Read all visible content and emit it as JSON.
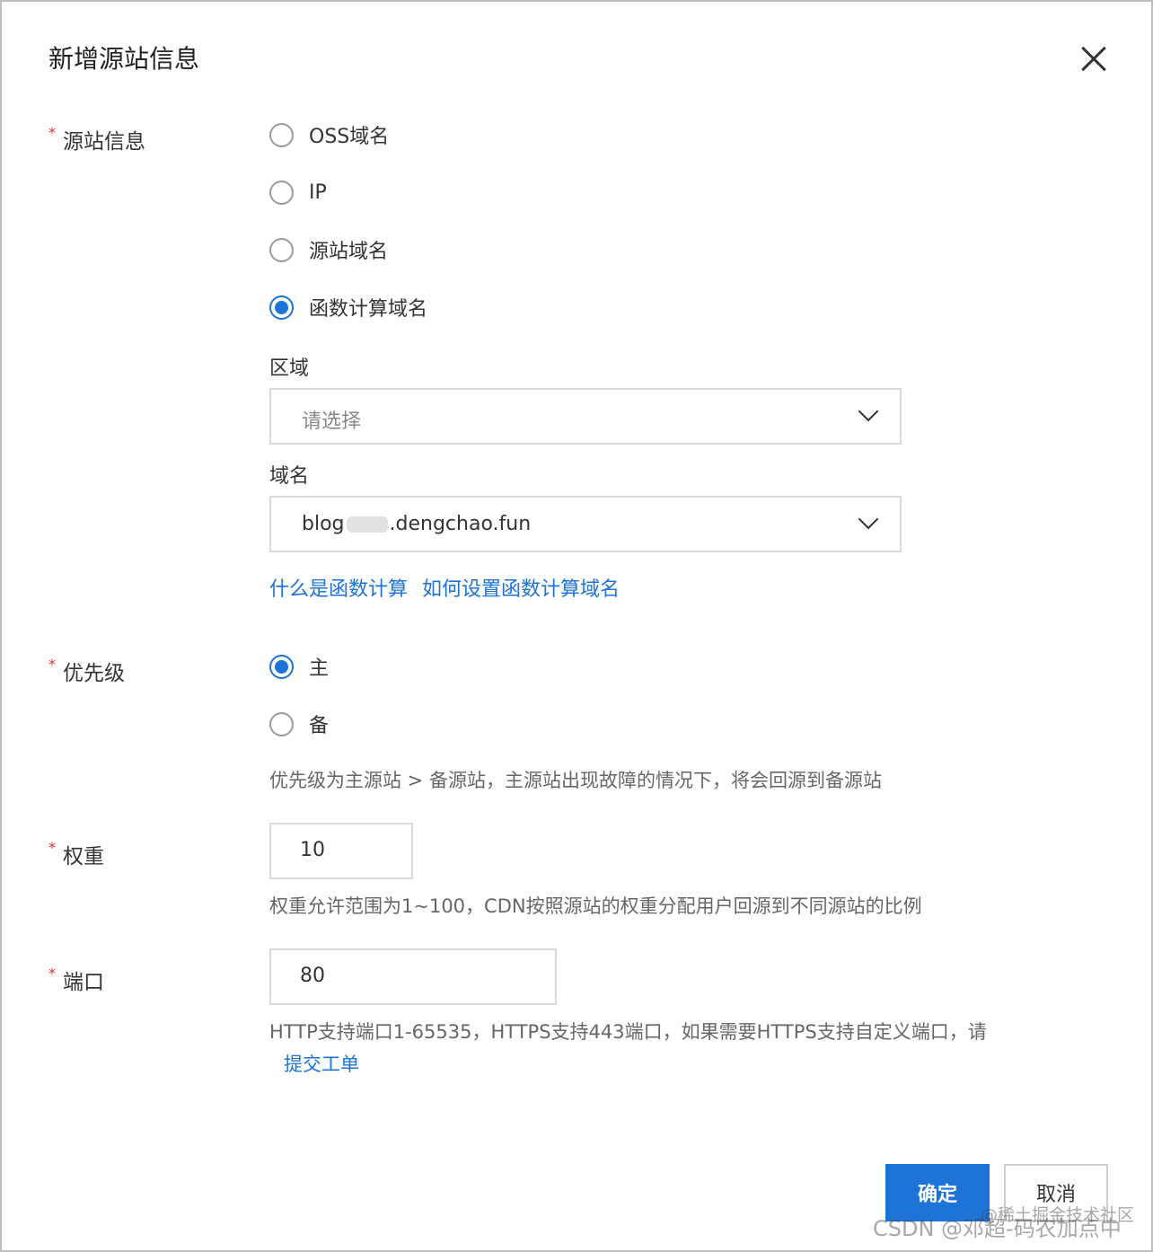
{
  "dialog": {
    "title": "新增源站信息"
  },
  "origin_info": {
    "label": "源站信息",
    "required_mark": "*",
    "options": [
      {
        "label": "OSS域名",
        "checked": false
      },
      {
        "label": "IP",
        "checked": false
      },
      {
        "label": "源站域名",
        "checked": false
      },
      {
        "label": "函数计算域名",
        "checked": true
      }
    ],
    "region": {
      "label": "区域",
      "placeholder": "请选择"
    },
    "domain": {
      "label": "域名",
      "value_prefix": "blog",
      "value_suffix": ".dengchao.fun"
    },
    "links": [
      "什么是函数计算",
      "如何设置函数计算域名"
    ]
  },
  "priority": {
    "label": "优先级",
    "required_mark": "*",
    "options": [
      {
        "label": "主",
        "checked": true
      },
      {
        "label": "备",
        "checked": false
      }
    ],
    "help": "优先级为主源站 > 备源站，主源站出现故障的情况下，将会回源到备源站"
  },
  "weight": {
    "label": "权重",
    "required_mark": "*",
    "value": "10",
    "help": "权重允许范围为1~100，CDN按照源站的权重分配用户回源到不同源站的比例"
  },
  "port": {
    "label": "端口",
    "required_mark": "*",
    "value": "80",
    "help_line1": "HTTP支持端口1-65535，HTTPS支持443端口，如果需要HTTPS支持自定义端口，请",
    "help_link": "提交工单"
  },
  "buttons": {
    "confirm": "确定",
    "cancel": "取消"
  },
  "watermarks": {
    "juejin": "@稀土掘金技术社区",
    "csdn": "CSDN @邓超-码农加点中"
  },
  "colors": {
    "primary": "#1e73d6",
    "required": "#e03030"
  }
}
